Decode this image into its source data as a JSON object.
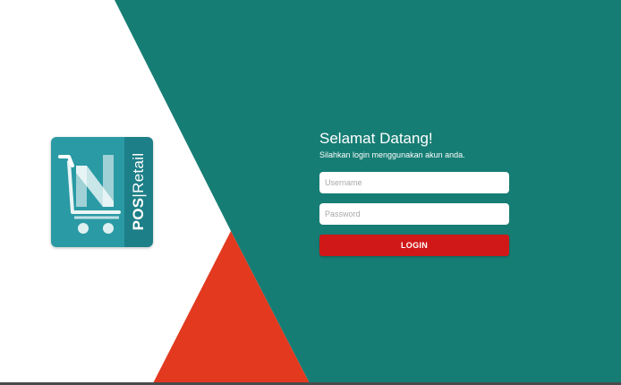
{
  "colors": {
    "teal_panel": "#167d74",
    "red_triangle": "#e2391f",
    "white_background": "#ffffff",
    "login_button": "#d01818",
    "logo_light": "#2a9aa4",
    "logo_dark": "#1d7f87"
  },
  "logo": {
    "brand_pos": "POS",
    "brand_separator": "|",
    "brand_retail": "Retail",
    "icon": "shopping-cart-icon"
  },
  "login": {
    "title": "Selamat Datang!",
    "subtitle": "Silahkan login menggunakan akun anda.",
    "username_placeholder": "Username",
    "password_placeholder": "Password",
    "button_label": "LOGIN"
  }
}
